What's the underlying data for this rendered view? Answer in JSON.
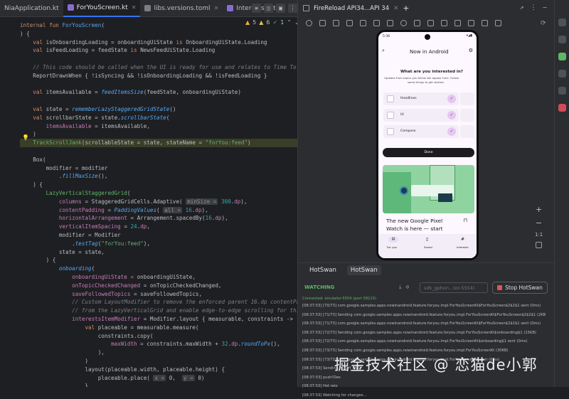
{
  "tabs": [
    {
      "label": "NiaApplication.kt",
      "active": false
    },
    {
      "label": "ForYouScreen.kt",
      "active": true
    },
    {
      "label": "libs.versions.toml",
      "active": false
    },
    {
      "label": "InterestsDeta",
      "active": false
    }
  ],
  "inspections": {
    "warnings": "5",
    "weak": "6",
    "ok": "1"
  },
  "code_lines": [
    "internal fun ForYouScreen(",
    ") {",
    "    val isOnboardingLoading = onboardingUiState is OnboardingUiState.Loading",
    "    val isFeedLoading = feedState is NewsFeedUiState.Loading",
    "",
    "    // This code should be called when the UI is ready for use and relates to Time To Full Display.",
    "    ReportDrawnWhen { !isSyncing && !isOnboardingLoading && !isFeedLoading }",
    "",
    "    val itemsAvailable = feedItemsSize(feedState, onboardingUiState)",
    "",
    "    val state = rememberLazyStaggeredGridState()",
    "    val scrollbarState = state.scrollbarState(",
    "        itemsAvailable = itemsAvailable,",
    "    )",
    "    TrackScrollJank(scrollableState = state, stateName = \"forYou:feed\")",
    "",
    "    Box(",
    "        modifier = modifier",
    "            .fillMaxSize(),",
    "    ) {",
    "        LazyVerticalStaggeredGrid(",
    "            columns = StaggeredGridCells.Adaptive( minSize = 300.dp),",
    "            contentPadding = PaddingValues( all = 16.dp),",
    "            horizontalArrangement = Arrangement.spacedBy(16.dp),",
    "            verticalItemSpacing = 24.dp,",
    "            modifier = Modifier",
    "                .testTag(\"forYou:feed\"),",
    "            state = state,",
    "        ) {",
    "            onboarding(",
    "                onboardingUiState = onboardingUiState,",
    "                onTopicCheckedChanged = onTopicCheckedChanged,",
    "                saveFollowedTopics = saveFollowedTopics,",
    "                // Custom LayoutModifier to remove the enforced parent 16.dp contentPadding",
    "                // from the LazyVerticalGrid and enable edge-to-edge scrolling for this section",
    "                interestsItemModifier = Modifier.layout { measurable, constraints ->",
    "                    val placeable = measurable.measure(",
    "                        constraints.copy(",
    "                            maxWidth = constraints.maxWidth + 32.dp.roundToPx(),",
    "                        ),",
    "                    )",
    "                    layout(placeable.width, placeable.height) {",
    "                        placeable.place( x = 0,  y = 0)",
    "                    }"
  ],
  "device": {
    "title": "FireReload API34...API 34",
    "status_time": "5:36",
    "app_title": "Now in Android",
    "question": "What are you interested in?",
    "subtitle_line1": "Updates from topics you follow will appear here. Follow",
    "subtitle_line2": "some things to get started.",
    "topics": [
      "Headlines",
      "UI",
      "Compose"
    ],
    "done_label": "Done",
    "card_title_line1": "The new Google Pixel",
    "card_title_line2": "Watch is here  — start",
    "nav": [
      "For you",
      "Saved",
      "Interests"
    ],
    "zoom_label": "1:1"
  },
  "hotswan": {
    "tabs": [
      "HotSwan",
      "HotSwan"
    ],
    "status": "WATCHING",
    "device_select": "sdk_gphon...tor-5554)",
    "stop_label": "Stop HotSwan",
    "connected": "Connected: emulator-5554 (port 58115)",
    "logs": [
      "[08:37:53]   [70/73] com.google.samples.apps.nowinandroid.feature.foryou.impl.ForYouScreenKt$ForYouScreen$2$2$1 sent (0ms)",
      "[08:37:53]   [71/73] Sending com.google.samples.apps.nowinandroid.feature.foryou.impl.ForYouScreenKt$ForYouScreen$2$2$1 (2KB",
      "[08:37:53]   [71/73] com.google.samples.apps.nowinandroid.feature.foryou.impl.ForYouScreenKt$ForYouScreen$2$2$1 sent (0ms)",
      "[08:37:53]   [72/73] Sending com.google.samples.apps.nowinandroid.feature.foryou.impl.ForYouScreenKt$onboarding$1 (15KB)",
      "[08:37:53]   [72/73] com.google.samples.apps.nowinandroid.feature.foryou.impl.ForYouScreenKt$onboarding$1 sent (0ms)",
      "[08:37:53]   [73/73] Sending com.google.samples.apps.nowinandroid.feature.foryou.impl.ForYouScreenKt (30KB)",
      "[08:37:53]   [73/73] com.google.samples.apps.nowinandroid.feature.foryou.impl.ForYouScreenKt sent (0ms)",
      "[08:37:53] Sending PATCH_END",
      "[08:37:53] push!Dex",
      "[08:37:53] Hot relo",
      "[08:37:53] Watching for changes..."
    ]
  },
  "watermark": "掘金技术社区 @ 恋猫de小郭"
}
